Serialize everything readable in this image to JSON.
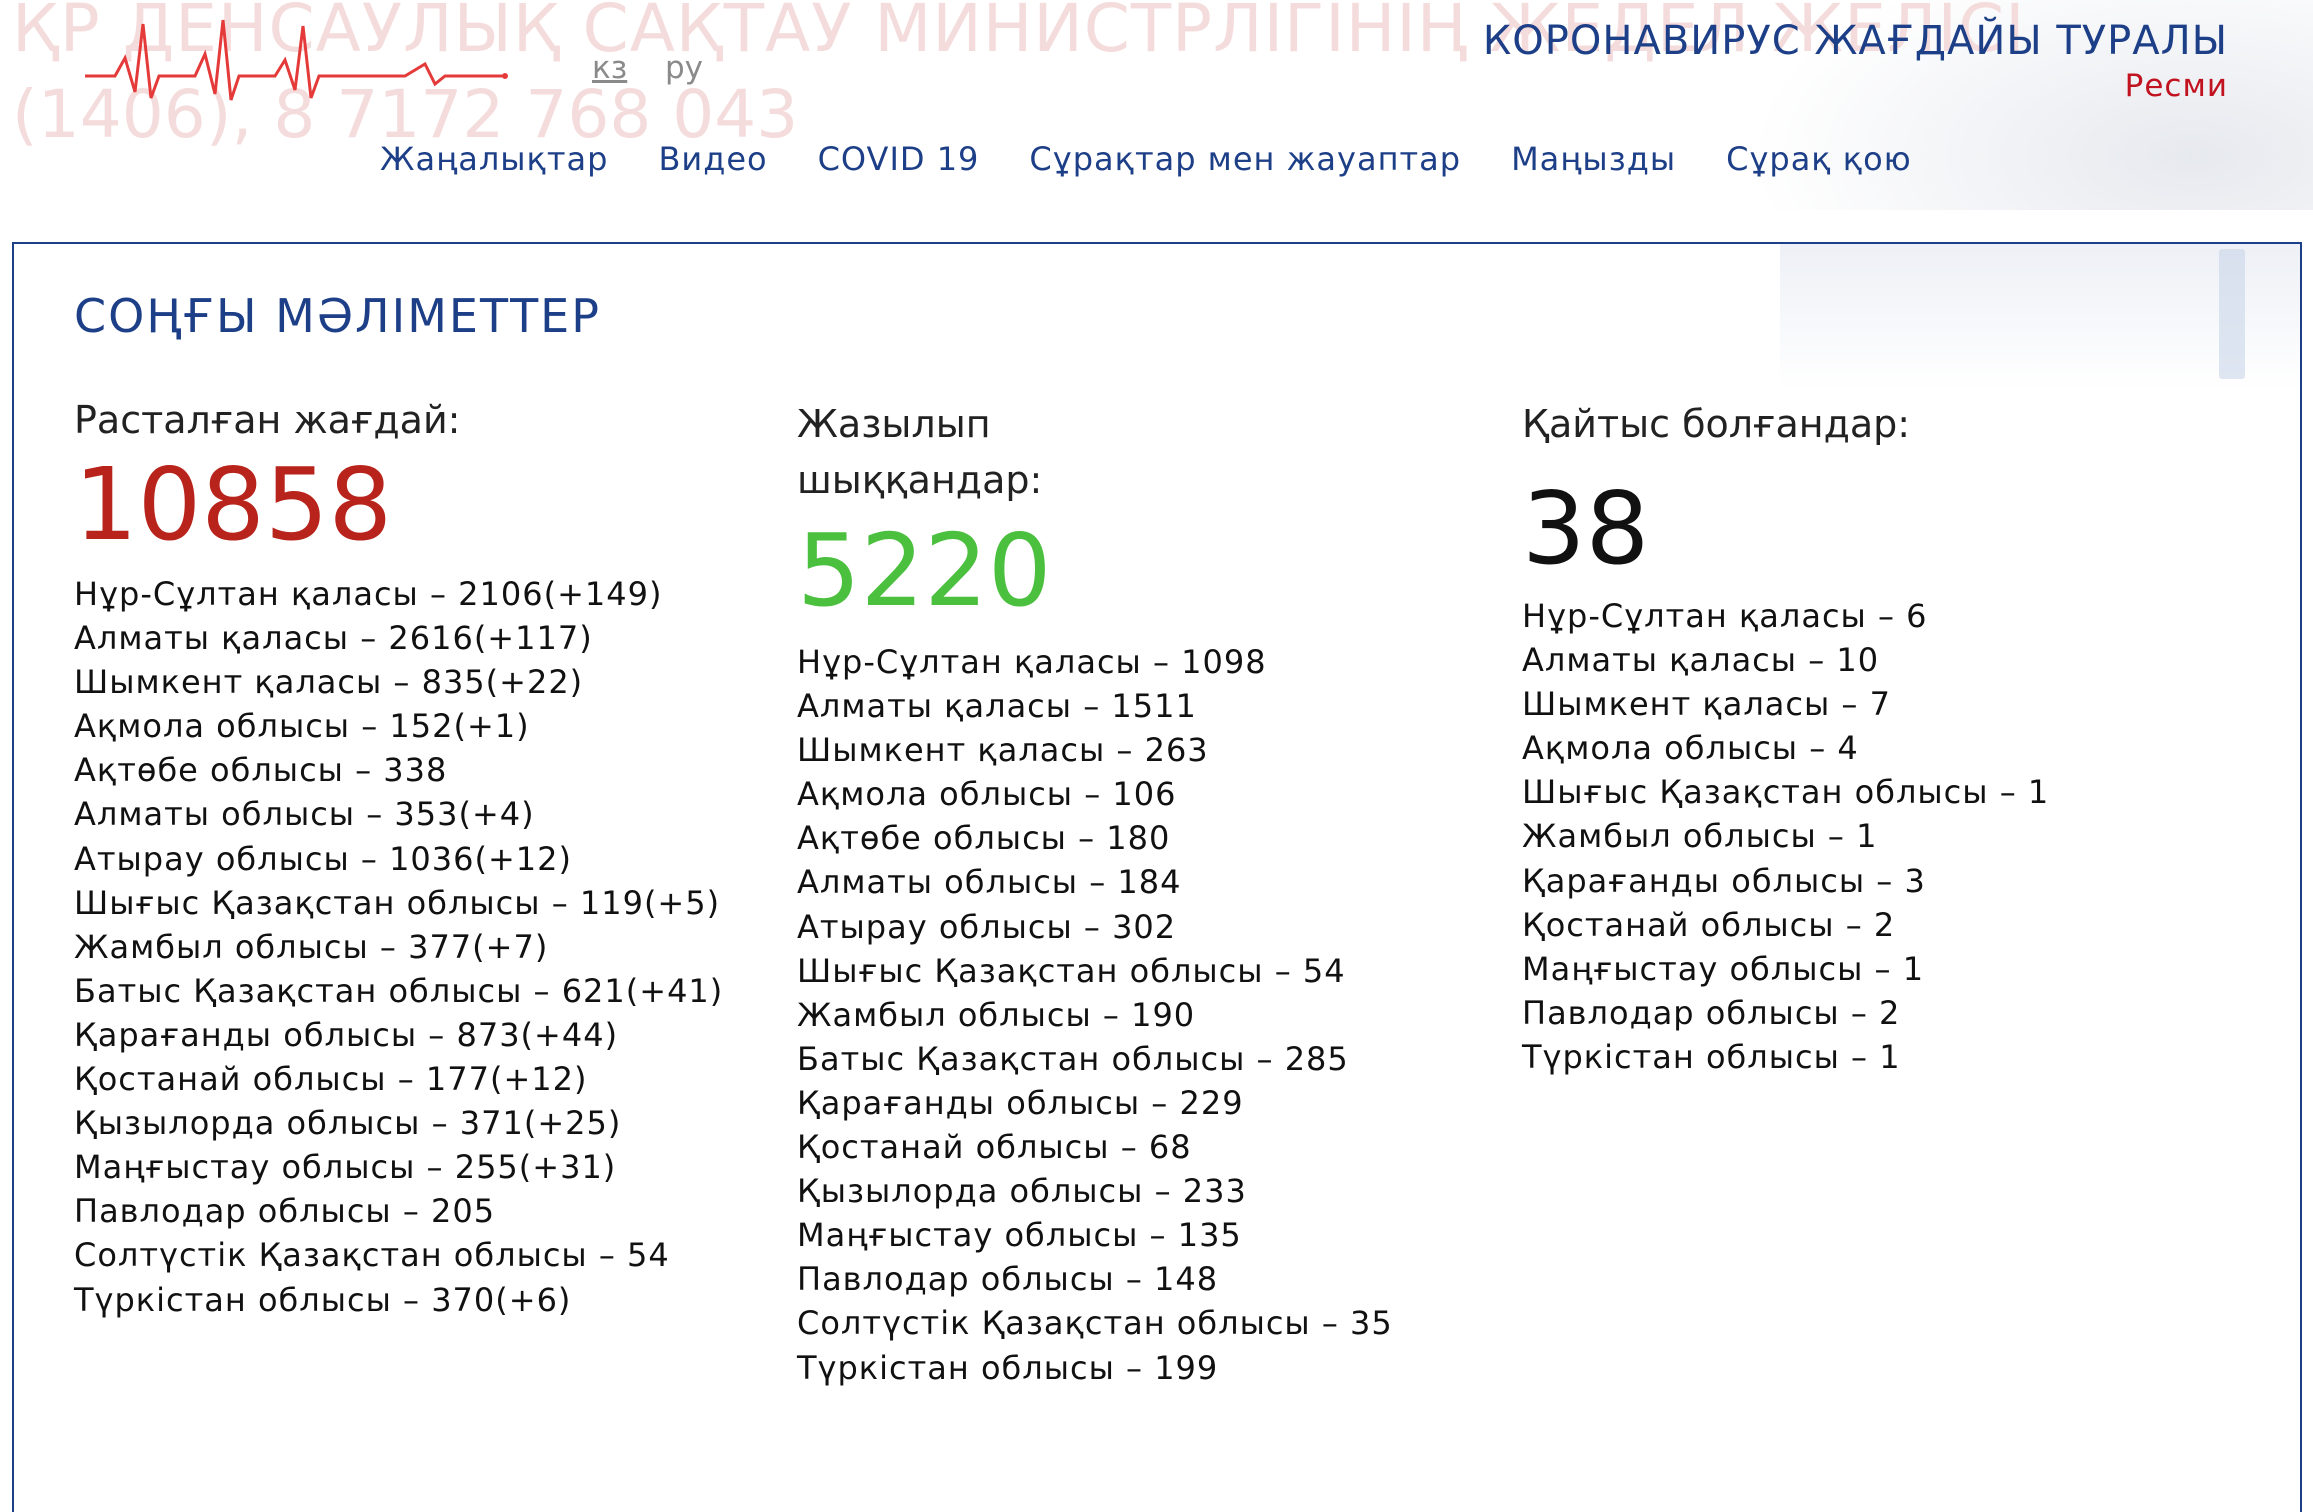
{
  "background": {
    "line1": "ҚР ДЕНСАУЛЫҚ САҚТАУ МИНИСТРЛІГІНІҢ ЖЕДЕЛ ЖЕЛІСІ",
    "line2": "(1406), 8 7172 768 043"
  },
  "header": {
    "lang_kz": "кз",
    "lang_ru": "ру",
    "title": "КОРОНАВИРУС ЖАҒДАЙЫ ТУРАЛЫ",
    "subtitle": "Ресми"
  },
  "nav": {
    "items": [
      {
        "label": "Жаңалықтар"
      },
      {
        "label": "Видео"
      },
      {
        "label": "COVID 19"
      },
      {
        "label": "Сұрақтар мен жауаптар"
      },
      {
        "label": "Маңызды"
      },
      {
        "label": "Сұрақ қою"
      }
    ]
  },
  "colors": {
    "brand_blue": "#1d3f87",
    "confirmed_red": "#b8231b",
    "recovered_green": "#4bbf3e",
    "logo_red": "#e53a3a"
  },
  "stats": {
    "title": "СОҢҒЫ МӘЛІМЕТТЕР",
    "confirmed": {
      "label": "Расталған жағдай:",
      "total": "10858",
      "regions": [
        "Нұр-Сұлтан қаласы – 2106(+149)",
        "Алматы қаласы – 2616(+117)",
        "Шымкент қаласы – 835(+22)",
        "Ақмола облысы – 152(+1)",
        "Ақтөбе облысы – 338",
        "Алматы облысы – 353(+4)",
        "Атырау облысы – 1036(+12)",
        "Шығыс Қазақстан облысы – 119(+5)",
        "Жамбыл облысы – 377(+7)",
        "Батыс Қазақстан облысы – 621(+41)",
        "Қарағанды облысы – 873(+44)",
        "Қостанай облысы – 177(+12)",
        "Қызылорда облысы – 371(+25)",
        "Маңғыстау облысы – 255(+31)",
        "Павлодар облысы – 205",
        "Солтүстік Қазақстан облысы – 54",
        "Түркістан облысы – 370(+6)"
      ]
    },
    "recovered": {
      "label_line1": "Жазылып",
      "label_line2": "шыққандар:",
      "total": "5220",
      "regions": [
        "Нұр-Сұлтан қаласы – 1098",
        "Алматы қаласы – 1511",
        "Шымкент қаласы – 263",
        "Ақмола облысы – 106",
        "Ақтөбе облысы – 180",
        "Алматы облысы – 184",
        "Атырау облысы – 302",
        "Шығыс Қазақстан облысы – 54",
        "Жамбыл облысы – 190",
        "Батыс Қазақстан облысы – 285",
        "Қарағанды облысы – 229",
        "Қостанай облысы – 68",
        "Қызылорда облысы – 233",
        "Маңғыстау облысы – 135",
        "Павлодар облысы – 148",
        "Солтүстік Қазақстан облысы – 35",
        "Түркістан облысы – 199"
      ]
    },
    "deaths": {
      "label": "Қайтыс болғандар:",
      "total": "38",
      "regions": [
        "Нұр-Сұлтан қаласы – 6",
        "Алматы қаласы – 10",
        "Шымкент қаласы – 7",
        "Ақмола облысы – 4",
        "Шығыс Қазақстан облысы – 1",
        "Жамбыл облысы – 1",
        "Қарағанды облысы – 3",
        "Қостанай облысы – 2",
        "Маңғыстау облысы – 1",
        "Павлодар облысы – 2",
        "Түркістан облысы – 1"
      ]
    }
  }
}
